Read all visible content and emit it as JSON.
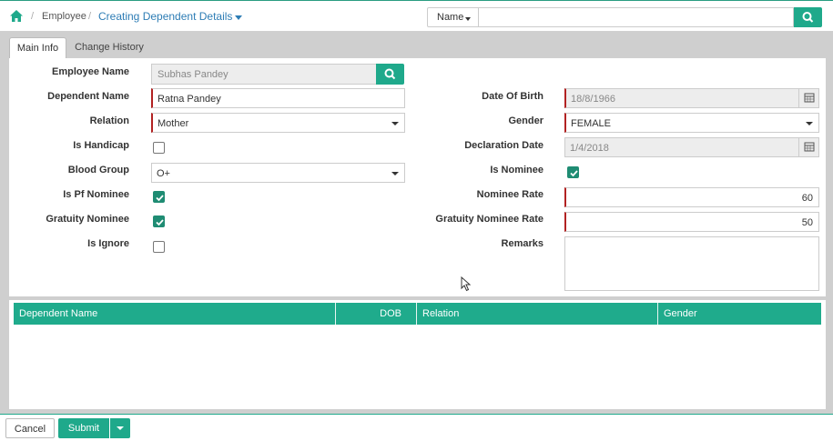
{
  "breadcrumb": {
    "home_icon": "home-icon",
    "items": [
      "Employee",
      "Creating Dependent Details"
    ],
    "separator": "/"
  },
  "search": {
    "field_selector": "Name",
    "value": "",
    "icon": "search-icon"
  },
  "tabs": [
    {
      "label": "Main Info",
      "active": true
    },
    {
      "label": "Change History",
      "active": false
    }
  ],
  "form": {
    "employee_name": {
      "label": "Employee Name",
      "value": "Subhas Pandey"
    },
    "dependent_name": {
      "label": "Dependent Name",
      "value": "Ratna Pandey"
    },
    "relation": {
      "label": "Relation",
      "value": "Mother"
    },
    "is_handicap": {
      "label": "Is Handicap",
      "checked": false
    },
    "blood_group": {
      "label": "Blood Group",
      "value": "O+"
    },
    "is_pf_nominee": {
      "label": "Is Pf Nominee",
      "checked": true
    },
    "gratuity_nominee": {
      "label": "Gratuity Nominee",
      "checked": true
    },
    "is_ignore": {
      "label": "Is Ignore",
      "checked": false
    },
    "date_of_birth": {
      "label": "Date Of Birth",
      "value": "18/8/1966"
    },
    "gender": {
      "label": "Gender",
      "value": "FEMALE"
    },
    "declaration_date": {
      "label": "Declaration Date",
      "value": "1/4/2018"
    },
    "is_nominee": {
      "label": "Is Nominee",
      "checked": true
    },
    "nominee_rate": {
      "label": "Nominee Rate",
      "value": "60"
    },
    "gratuity_nominee_rate": {
      "label": "Gratuity Nominee Rate",
      "value": "50"
    },
    "remarks": {
      "label": "Remarks",
      "value": ""
    }
  },
  "grid": {
    "columns": [
      "Dependent Name",
      "DOB",
      "Relation",
      "Gender"
    ],
    "rows": []
  },
  "footer": {
    "cancel_label": "Cancel",
    "submit_label": "Submit"
  },
  "colors": {
    "accent": "#1fa98b",
    "link": "#2e7db5",
    "required": "#b22222"
  }
}
